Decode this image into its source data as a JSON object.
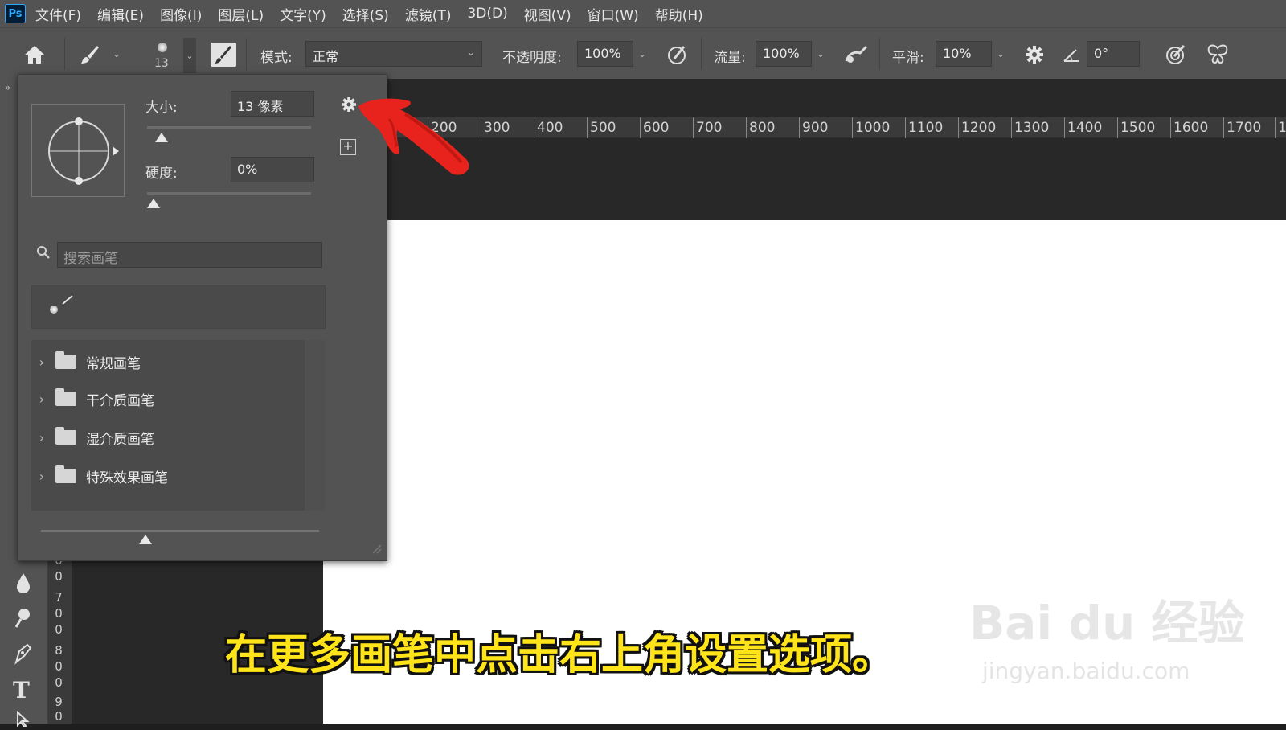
{
  "app": {
    "logo": "Ps"
  },
  "menu": [
    "文件(F)",
    "编辑(E)",
    "图像(I)",
    "图层(L)",
    "文字(Y)",
    "选择(S)",
    "滤镜(T)",
    "3D(D)",
    "视图(V)",
    "窗口(W)",
    "帮助(H)"
  ],
  "options": {
    "brush_size_value": "13",
    "mode_label": "模式:",
    "mode_value": "正常",
    "opacity_label": "不透明度:",
    "opacity_value": "100%",
    "flow_label": "流量:",
    "flow_value": "100%",
    "smoothing_label": "平滑:",
    "smoothing_value": "10%",
    "angle_value": "0°"
  },
  "brush_panel": {
    "size_label": "大小:",
    "size_value": "13 像素",
    "size_slider_fraction": 0.05,
    "hardness_label": "硬度:",
    "hardness_value": "0%",
    "hardness_slider_fraction": 0.0,
    "search_placeholder": "搜索画笔",
    "folders": [
      "常规画笔",
      "干介质画笔",
      "湿介质画笔",
      "特殊效果画笔"
    ]
  },
  "ruler_h": [
    "200",
    "300",
    "400",
    "500",
    "600",
    "700",
    "800",
    "900",
    "1000",
    "1100",
    "1200",
    "1300",
    "1400",
    "1500",
    "1600",
    "1700",
    "1"
  ],
  "ruler_v": [
    "0",
    "0",
    "7",
    "0",
    "0",
    "8",
    "0",
    "0",
    "9",
    "0"
  ],
  "subtitle": "在更多画笔中点击右上角设置选项。",
  "watermark": {
    "main": "Bai du 经验",
    "sub": "jingyan.baidu.com"
  },
  "colors": {
    "accent_arrow": "#e8231d",
    "subtitle": "#ffe41a",
    "ps_blue": "#31a8ff"
  }
}
